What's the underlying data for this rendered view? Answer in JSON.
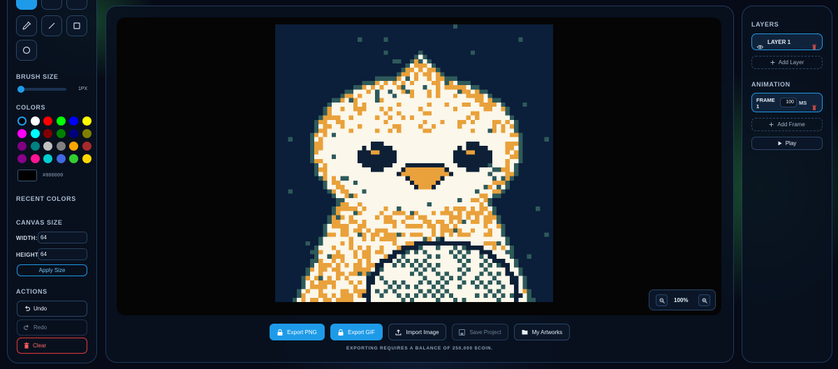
{
  "left": {
    "brush_size": {
      "title": "BRUSH SIZE",
      "value_label": "1PX",
      "value": 1
    },
    "colors": {
      "title": "COLORS",
      "palette": [
        "#000000",
        "#ffffff",
        "#ff0000",
        "#00ff00",
        "#0000ff",
        "#ffff00",
        "#ff00ff",
        "#00ffff",
        "#800000",
        "#008000",
        "#000080",
        "#808000",
        "#800080",
        "#008080",
        "#c0c0c0",
        "#808080",
        "#ffa500",
        "#a52a2a",
        "#8b008b",
        "#ff1493",
        "#00ced1",
        "#4169e1",
        "#32cd32",
        "#ffd700"
      ],
      "current_hex": "#000000"
    },
    "recent_colors": {
      "title": "RECENT COLORS"
    },
    "canvas_size": {
      "title": "CANVAS SIZE",
      "width_label": "WIDTH:",
      "width_value": "64",
      "height_label": "HEIGHT:",
      "height_value": "64",
      "apply_label": "Apply Size"
    },
    "actions": {
      "title": "ACTIONS",
      "undo": "Undo",
      "redo": "Redo",
      "clear": "Clear"
    },
    "tools": [
      "tool-1",
      "tool-2",
      "tool-3",
      "eyedropper",
      "line",
      "rectangle",
      "circle"
    ]
  },
  "center": {
    "zoom_label": "100%",
    "buttons": {
      "export_png": "Export PNG",
      "export_gif": "Export GIF",
      "import_image": "Import Image",
      "save_project": "Save Project",
      "my_artworks": "My Artworks"
    },
    "notice": "EXPORTING REQUIRES A BALANCE OF 250,000 $COIN."
  },
  "right": {
    "layers": {
      "title": "LAYERS",
      "items": [
        {
          "label": "LAYER 1"
        }
      ],
      "add_label": "Add Layer"
    },
    "animation": {
      "title": "ANIMATION",
      "frames": [
        {
          "label": "FRAME 1",
          "duration": "100",
          "unit": "MS"
        }
      ],
      "add_label": "Add Frame",
      "play_label": "Play"
    }
  },
  "colors": {
    "accent": "#1e9be8",
    "danger": "#e23b3b",
    "canvas_bg": "#0b1e3a",
    "bird_body": "#fbf7ea",
    "bird_outline": "#2e5a5a",
    "bird_dark": "#0d2036",
    "bird_orange": "#e9a13b"
  }
}
